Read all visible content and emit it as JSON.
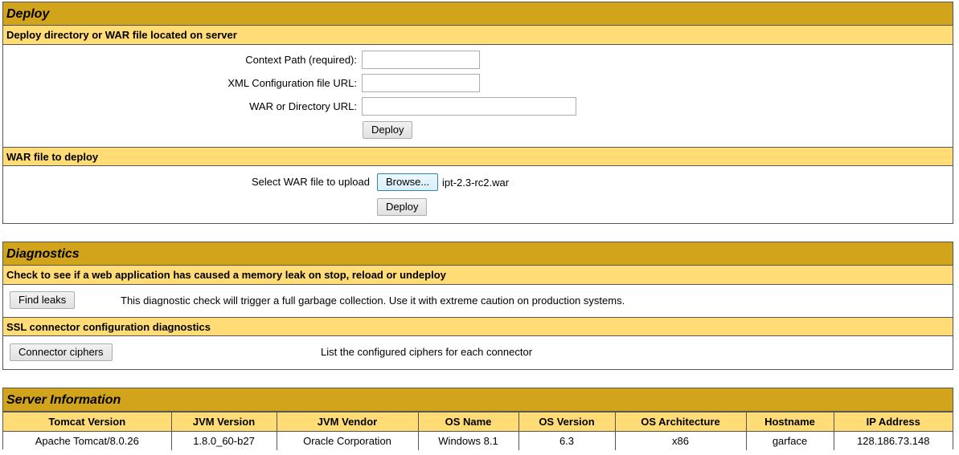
{
  "deploy": {
    "title": "Deploy",
    "server_section": {
      "title": "Deploy directory or WAR file located on server",
      "context_path_label": "Context Path (required):",
      "context_path_value": "",
      "xml_config_label": "XML Configuration file URL:",
      "xml_config_value": "",
      "war_dir_label": "WAR or Directory URL:",
      "war_dir_value": "",
      "deploy_button": "Deploy"
    },
    "upload_section": {
      "title": "WAR file to deploy",
      "select_label": "Select WAR file to upload",
      "browse_button": "Browse...",
      "selected_file": "ipt-2.3-rc2.war",
      "deploy_button": "Deploy"
    }
  },
  "diagnostics": {
    "title": "Diagnostics",
    "leaks_section": {
      "title": "Check to see if a web application has caused a memory leak on stop, reload or undeploy",
      "button": "Find leaks",
      "description": "This diagnostic check will trigger a full garbage collection. Use it with extreme caution on production systems."
    },
    "ssl_section": {
      "title": "SSL connector configuration diagnostics",
      "button": "Connector ciphers",
      "description": "List the configured ciphers for each connector"
    }
  },
  "server_info": {
    "title": "Server Information",
    "columns": [
      "Tomcat Version",
      "JVM Version",
      "JVM Vendor",
      "OS Name",
      "OS Version",
      "OS Architecture",
      "Hostname",
      "IP Address"
    ],
    "values": [
      "Apache Tomcat/8.0.26",
      "1.8.0_60-b27",
      "Oracle Corporation",
      "Windows 8.1",
      "6.3",
      "x86",
      "garface",
      "128.186.73.148"
    ]
  }
}
